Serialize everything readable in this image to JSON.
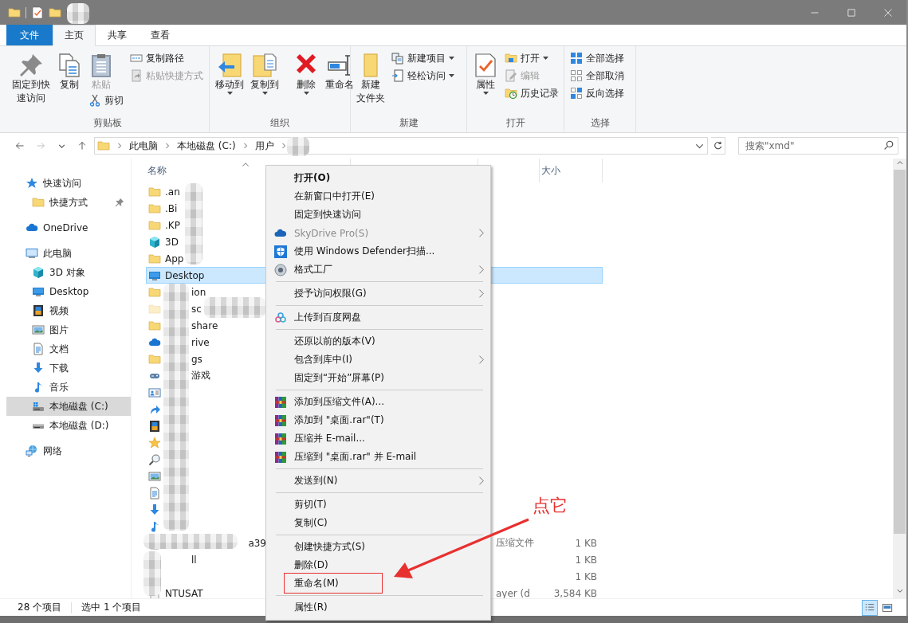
{
  "ribbon": {
    "tabs": [
      {
        "label": "文件",
        "kind": "file",
        "selected": false
      },
      {
        "label": "主页",
        "kind": "tab",
        "selected": true
      },
      {
        "label": "共享",
        "kind": "tab",
        "selected": false
      },
      {
        "label": "查看",
        "kind": "tab",
        "selected": false
      }
    ],
    "groups": [
      {
        "label": "剪贴板",
        "columns": [
          {
            "kind": "large",
            "buttons": [
              {
                "kind": "pin",
                "lines": [
                  "固定到快",
                  "速访问"
                ],
                "disabled": false,
                "dropdown": false
              }
            ]
          },
          {
            "kind": "large",
            "buttons": [
              {
                "kind": "copy",
                "lines": [
                  "复制"
                ],
                "disabled": false,
                "dropdown": false
              }
            ]
          },
          {
            "kind": "mixed",
            "buttons": [
              {
                "kind": "paste",
                "lines": [
                  "粘贴"
                ],
                "disabled": true,
                "dropdown": false
              },
              {
                "kind": "cut",
                "lines": [
                  "剪切"
                ],
                "disabled": false,
                "dropdown": false
              }
            ]
          },
          {
            "kind": "small",
            "buttons": [
              {
                "kind": "copy-path",
                "lines": [
                  "复制路径"
                ],
                "disabled": false,
                "dropdown": false
              },
              {
                "kind": "paste-shortcut",
                "lines": [
                  "粘贴快捷方式"
                ],
                "disabled": true,
                "dropdown": false
              }
            ]
          }
        ]
      },
      {
        "label": "组织",
        "columns": [
          {
            "kind": "large",
            "buttons": [
              {
                "kind": "move-to",
                "lines": [
                  "移动到"
                ],
                "disabled": false,
                "dropdown": true
              }
            ]
          },
          {
            "kind": "large",
            "buttons": [
              {
                "kind": "copy-to",
                "lines": [
                  "复制到"
                ],
                "disabled": false,
                "dropdown": true
              }
            ]
          },
          {
            "kind": "divider"
          },
          {
            "kind": "large",
            "buttons": [
              {
                "kind": "delete",
                "lines": [
                  "删除"
                ],
                "disabled": false,
                "dropdown": true
              }
            ]
          },
          {
            "kind": "large",
            "buttons": [
              {
                "kind": "rename",
                "lines": [
                  "重命名"
                ],
                "disabled": false,
                "dropdown": false
              }
            ]
          }
        ]
      },
      {
        "label": "新建",
        "columns": [
          {
            "kind": "large",
            "buttons": [
              {
                "kind": "new-folder",
                "lines": [
                  "新建",
                  "文件夹"
                ],
                "disabled": false,
                "dropdown": false
              }
            ]
          },
          {
            "kind": "small",
            "buttons": [
              {
                "kind": "new-item",
                "lines": [
                  "新建项目"
                ],
                "disabled": false,
                "dropdown": true
              },
              {
                "kind": "easy-access",
                "lines": [
                  "轻松访问"
                ],
                "disabled": false,
                "dropdown": true
              }
            ]
          }
        ]
      },
      {
        "label": "打开",
        "columns": [
          {
            "kind": "large",
            "buttons": [
              {
                "kind": "properties",
                "lines": [
                  "属性"
                ],
                "disabled": false,
                "dropdown": true
              }
            ]
          },
          {
            "kind": "small",
            "buttons": [
              {
                "kind": "open",
                "lines": [
                  "打开"
                ],
                "disabled": false,
                "dropdown": true
              },
              {
                "kind": "edit",
                "lines": [
                  "编辑"
                ],
                "disabled": true,
                "dropdown": false
              },
              {
                "kind": "history",
                "lines": [
                  "历史记录"
                ],
                "disabled": false,
                "dropdown": false
              }
            ]
          }
        ]
      },
      {
        "label": "选择",
        "columns": [
          {
            "kind": "small",
            "buttons": [
              {
                "kind": "select-all",
                "lines": [
                  "全部选择"
                ],
                "disabled": false,
                "dropdown": false
              },
              {
                "kind": "select-none",
                "lines": [
                  "全部取消"
                ],
                "disabled": false,
                "dropdown": false
              },
              {
                "kind": "invert",
                "lines": [
                  "反向选择"
                ],
                "disabled": false,
                "dropdown": false
              }
            ]
          }
        ]
      }
    ]
  },
  "address": {
    "path": [
      "此电脑",
      "本地磁盘 (C:)",
      "用户"
    ],
    "search_placeholder": "搜索\"xmd\""
  },
  "sidebar": {
    "items": [
      {
        "kind": "quick",
        "label": "快速访问",
        "selected": false,
        "pinned": false,
        "children": [
          {
            "kind": "folder",
            "label": "快捷方式",
            "selected": false,
            "pinned": true
          }
        ]
      },
      {
        "kind": "onedrive",
        "label": "OneDrive",
        "selected": false,
        "pinned": false
      },
      {
        "kind": "pc",
        "label": "此电脑",
        "selected": false,
        "pinned": false,
        "children": [
          {
            "kind": "cube",
            "label": "3D 对象",
            "selected": false,
            "pinned": false
          },
          {
            "kind": "desktop",
            "label": "Desktop",
            "selected": false,
            "pinned": false
          },
          {
            "kind": "video",
            "label": "视频",
            "selected": false,
            "pinned": false
          },
          {
            "kind": "picture",
            "label": "图片",
            "selected": false,
            "pinned": false
          },
          {
            "kind": "document",
            "label": "文档",
            "selected": false,
            "pinned": false
          },
          {
            "kind": "download",
            "label": "下载",
            "selected": false,
            "pinned": false
          },
          {
            "kind": "music",
            "label": "音乐",
            "selected": false,
            "pinned": false
          },
          {
            "kind": "drive-c",
            "label": "本地磁盘 (C:)",
            "selected": true,
            "pinned": false
          },
          {
            "kind": "drive",
            "label": "本地磁盘 (D:)",
            "selected": false,
            "pinned": false
          }
        ]
      },
      {
        "kind": "network",
        "label": "网络",
        "selected": false,
        "pinned": false
      }
    ]
  },
  "table": {
    "columns": [
      {
        "kind": "name",
        "label": "名称"
      },
      {
        "kind": "size",
        "label": "大小"
      }
    ],
    "rows": [
      {
        "kind": "folder",
        "name_start": ".an",
        "selected": false
      },
      {
        "kind": "folder",
        "name_start": ".Bi",
        "selected": false
      },
      {
        "kind": "folder",
        "name_start": ".KP",
        "selected": false
      },
      {
        "kind": "cube",
        "name_start": "3D",
        "selected": false
      },
      {
        "kind": "folder",
        "name_start": "App",
        "selected": false
      },
      {
        "kind": "desktop",
        "name_start": "Desktop",
        "selected": true
      },
      {
        "kind": "folder",
        "name_end": "ion",
        "selected": false
      },
      {
        "kind": "folder-faded",
        "name_end": "sc",
        "selected": false
      },
      {
        "kind": "folder",
        "name_end": "share",
        "selected": false
      },
      {
        "kind": "onedrive",
        "name_end": "rive",
        "selected": false
      },
      {
        "kind": "folder",
        "name_end": "gs",
        "selected": false
      },
      {
        "kind": "games",
        "name_end": "游戏",
        "selected": false
      },
      {
        "kind": "contacts",
        "selected": false
      },
      {
        "kind": "link",
        "selected": false
      },
      {
        "kind": "video",
        "selected": false
      },
      {
        "kind": "star",
        "selected": false
      },
      {
        "kind": "search",
        "selected": false
      },
      {
        "kind": "picture",
        "selected": false
      },
      {
        "kind": "document",
        "selected": false
      },
      {
        "kind": "download",
        "selected": false
      },
      {
        "kind": "music",
        "selected": false
      },
      {
        "kind": "file",
        "name_tail": "a39",
        "type": "压缩文件",
        "size": "1 KB",
        "selected": false
      },
      {
        "kind": "covered",
        "name_end": "ll",
        "size": "1 KB",
        "selected": false
      },
      {
        "kind": "covered",
        "size": "1 KB",
        "selected": false
      },
      {
        "kind": "file",
        "name_start": "NTUS",
        "name_end": "AT",
        "type": "ayer (d",
        "size": "3,584 KB",
        "selected": false
      }
    ]
  },
  "context_menu": {
    "items": [
      {
        "kind": "plain",
        "label": "打开(O)",
        "default": true,
        "disabled": false,
        "submenu": false,
        "boxed": false
      },
      {
        "kind": "plain",
        "label": "在新窗口中打开(E)",
        "default": false,
        "disabled": false,
        "submenu": false,
        "boxed": false
      },
      {
        "kind": "plain",
        "label": "固定到快速访问",
        "default": false,
        "disabled": false,
        "submenu": false,
        "boxed": false
      },
      {
        "kind": "skydrive",
        "label": "SkyDrive Pro(S)",
        "default": false,
        "disabled": true,
        "submenu": true,
        "boxed": false
      },
      {
        "kind": "defender",
        "label": "使用 Windows Defender扫描...",
        "default": false,
        "disabled": false,
        "submenu": false,
        "boxed": false
      },
      {
        "kind": "format-factory",
        "label": "格式工厂",
        "default": false,
        "disabled": false,
        "submenu": true,
        "boxed": false
      },
      {
        "kind": "separator"
      },
      {
        "kind": "plain",
        "label": "授予访问权限(G)",
        "default": false,
        "disabled": false,
        "submenu": true,
        "boxed": false
      },
      {
        "kind": "separator"
      },
      {
        "kind": "baidu",
        "label": "上传到百度网盘",
        "default": false,
        "disabled": false,
        "submenu": false,
        "boxed": false
      },
      {
        "kind": "separator"
      },
      {
        "kind": "plain",
        "label": "还原以前的版本(V)",
        "default": false,
        "disabled": false,
        "submenu": false,
        "boxed": false
      },
      {
        "kind": "plain",
        "label": "包含到库中(I)",
        "default": false,
        "disabled": false,
        "submenu": true,
        "boxed": false
      },
      {
        "kind": "plain",
        "label": "固定到“开始”屏幕(P)",
        "default": false,
        "disabled": false,
        "submenu": false,
        "boxed": false
      },
      {
        "kind": "separator"
      },
      {
        "kind": "archive",
        "label": "添加到压缩文件(A)...",
        "default": false,
        "disabled": false,
        "submenu": false,
        "boxed": false
      },
      {
        "kind": "archive",
        "label": "添加到 \"桌面.rar\"(T)",
        "default": false,
        "disabled": false,
        "submenu": false,
        "boxed": false
      },
      {
        "kind": "archive",
        "label": "压缩并 E-mail...",
        "default": false,
        "disabled": false,
        "submenu": false,
        "boxed": false
      },
      {
        "kind": "archive",
        "label": "压缩到 \"桌面.rar\" 并 E-mail",
        "default": false,
        "disabled": false,
        "submenu": false,
        "boxed": false
      },
      {
        "kind": "separator"
      },
      {
        "kind": "plain",
        "label": "发送到(N)",
        "default": false,
        "disabled": false,
        "submenu": true,
        "boxed": false
      },
      {
        "kind": "separator"
      },
      {
        "kind": "plain",
        "label": "剪切(T)",
        "default": false,
        "disabled": false,
        "submenu": false,
        "boxed": false
      },
      {
        "kind": "plain",
        "label": "复制(C)",
        "default": false,
        "disabled": false,
        "submenu": false,
        "boxed": false
      },
      {
        "kind": "separator"
      },
      {
        "kind": "plain",
        "label": "创建快捷方式(S)",
        "default": false,
        "disabled": false,
        "submenu": false,
        "boxed": false
      },
      {
        "kind": "plain",
        "label": "删除(D)",
        "default": false,
        "disabled": false,
        "submenu": false,
        "boxed": false
      },
      {
        "kind": "plain",
        "label": "重命名(M)",
        "default": false,
        "disabled": false,
        "submenu": false,
        "boxed": true
      },
      {
        "kind": "separator"
      },
      {
        "kind": "plain",
        "label": "属性(R)",
        "default": false,
        "disabled": false,
        "submenu": false,
        "boxed": false
      }
    ]
  },
  "annotation": {
    "label": "点它"
  },
  "status_bar": {
    "item_count": "28 个项目",
    "selection": "选中 1 个项目",
    "view_buttons": [
      {
        "kind": "details",
        "selected": true
      },
      {
        "kind": "thumbnails",
        "selected": false
      }
    ]
  }
}
